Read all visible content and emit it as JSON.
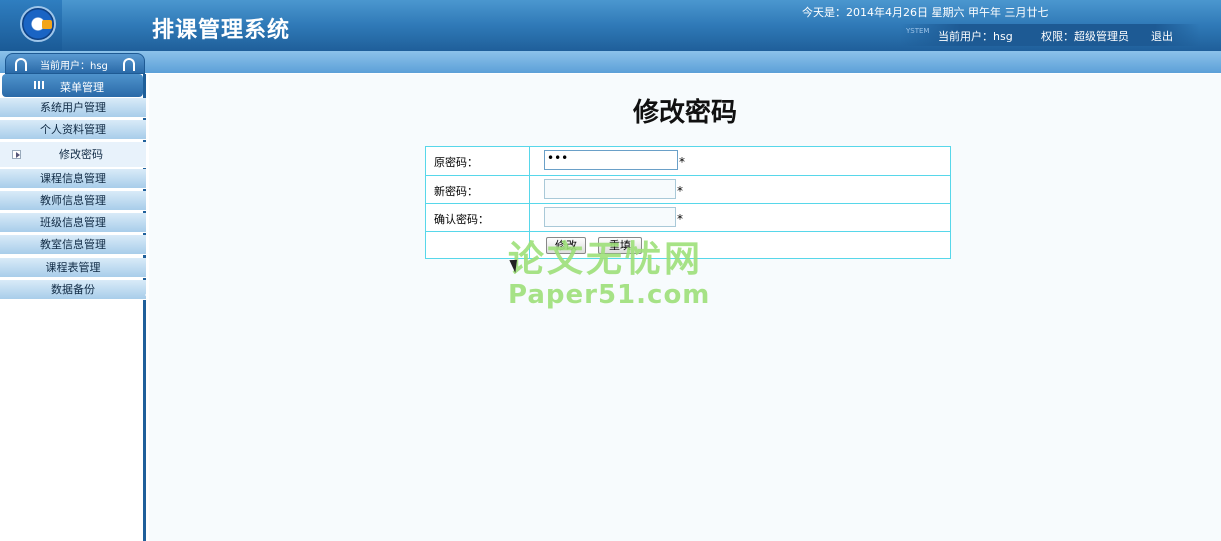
{
  "header": {
    "title": "排课管理系统",
    "date_text": "今天是：2014年4月26日 星期六 甲午年 三月廿七",
    "system_mark": "YSTEM",
    "current_user": "当前用户：hsg",
    "role": "权限：超级管理员",
    "logout": "退出"
  },
  "userbox": {
    "text": "当前用户：hsg"
  },
  "sidebar": {
    "menu_title": "菜单管理",
    "items": [
      {
        "label": "系统用户管理"
      },
      {
        "label": "个人资料管理"
      },
      {
        "label": "修改密码"
      },
      {
        "label": "课程信息管理"
      },
      {
        "label": "教师信息管理"
      },
      {
        "label": "班级信息管理"
      },
      {
        "label": "教室信息管理"
      },
      {
        "label": "课程表管理"
      },
      {
        "label": "数据备份"
      }
    ]
  },
  "main": {
    "page_title": "修改密码",
    "form": {
      "old_password_label": "原密码：",
      "old_password_value": "•••",
      "new_password_label": "新密码：",
      "new_password_value": "",
      "confirm_password_label": "确认密码：",
      "confirm_password_value": "",
      "required_mark": "*",
      "submit_label": "修改",
      "reset_label": "重填"
    }
  },
  "watermark": {
    "line1": "论文无忧网",
    "line2": "Paper51.com"
  },
  "colors": {
    "header": "#2f79b7",
    "table_border": "#57d7ea",
    "watermark": "#9ee07a"
  }
}
